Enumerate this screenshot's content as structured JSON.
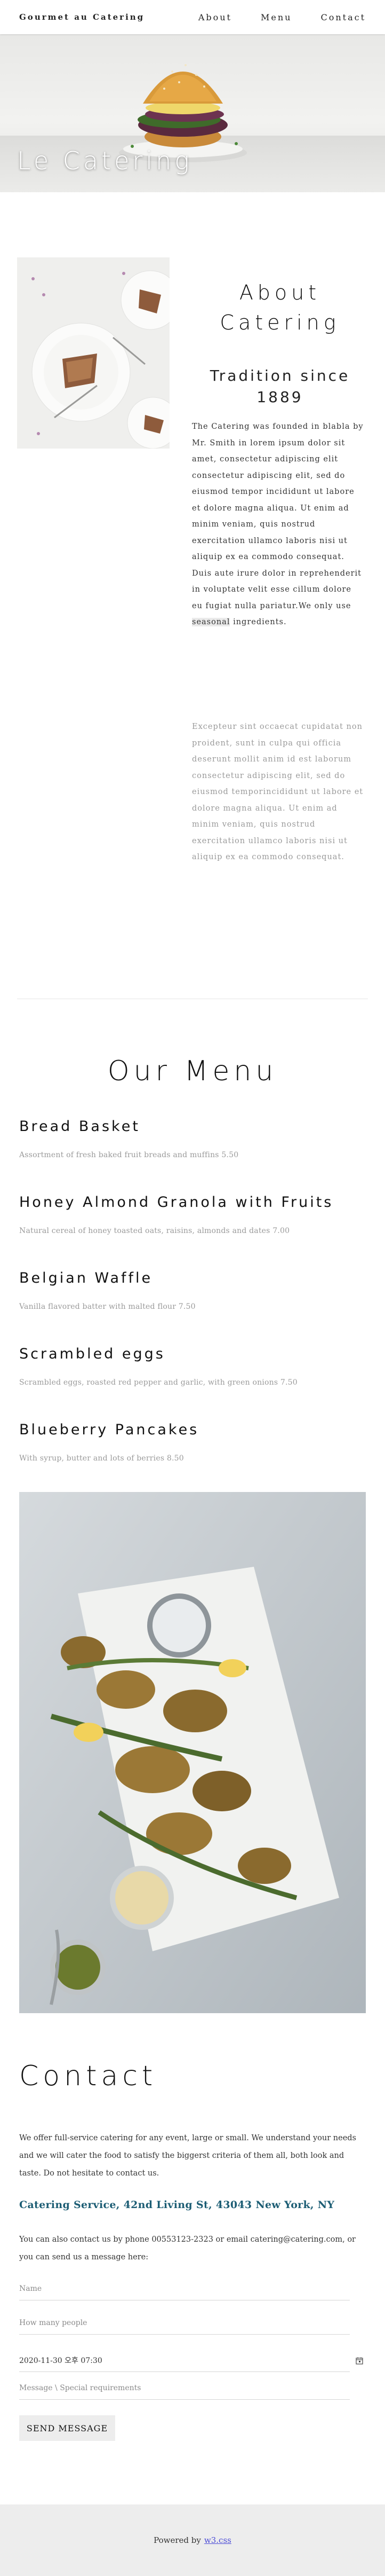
{
  "nav": {
    "brand": "Gourmet au Catering",
    "links": [
      "About",
      "Menu",
      "Contact"
    ]
  },
  "hero": {
    "title": "Le Catering"
  },
  "about": {
    "heading": "About Catering",
    "subheading": "Tradition since 1889",
    "paragraph1": "The Catering was founded in blabla by Mr. Smith in lorem ipsum dolor sit amet, consectetur adipiscing elit consectetur adipiscing elit, sed do eiusmod tempor incididunt ut labore et dolore magna aliqua. Ut enim ad minim veniam, quis nostrud exercitation ullamco laboris nisi ut aliquip ex ea commodo consequat. Duis aute irure dolor in reprehenderit in voluptate velit esse cillum dolore eu fugiat nulla pariatur.We only use ",
    "paragraph1_highlight": "seasonal",
    "paragraph1_end": " ingredients.",
    "paragraph2": "Excepteur sint occaecat cupidatat non proident, sunt in culpa qui officia deserunt mollit anim id est laborum consectetur adipiscing elit, sed do eiusmod temporincididunt ut labore et dolore magna aliqua. Ut enim ad minim veniam, quis nostrud exercitation ullamco laboris nisi ut aliquip ex ea commodo consequat."
  },
  "menu": {
    "title": "Our Menu",
    "items": [
      {
        "name": "Bread Basket",
        "desc": "Assortment of fresh baked fruit breads and muffins 5.50"
      },
      {
        "name": "Honey Almond Granola with Fruits",
        "desc": "Natural cereal of honey toasted oats, raisins, almonds and dates 7.00"
      },
      {
        "name": "Belgian Waffle",
        "desc": "Vanilla flavored batter with malted flour 7.50"
      },
      {
        "name": "Scrambled eggs",
        "desc": "Scrambled eggs, roasted red pepper and garlic, with green onions 7.50"
      },
      {
        "name": "Blueberry Pancakes",
        "desc": "With syrup, butter and lots of berries 8.50"
      }
    ]
  },
  "contact": {
    "title": "Contact",
    "paragraph": "We offer full-service catering for any event, large or small. We understand your needs and we will cater the food to satisfy the biggerst criteria of them all, both look and taste. Do not hesitate to contact us.",
    "address": "Catering Service, 42nd Living St, 43043 New York, NY",
    "paragraph2": "You can also contact us by phone 00553123-2323 or email catering@catering.com, or you can send us a message here:",
    "fields": {
      "name_placeholder": "Name",
      "people_placeholder": "How many people",
      "datetime_value": "2020-11-30 오후 07:30",
      "message_placeholder": "Message \\ Special requirements"
    },
    "send_label": "SEND MESSAGE"
  },
  "footer": {
    "powered_by": "Powered by",
    "link": "w3.css"
  },
  "colors": {
    "accent": "#1c5d74",
    "footer_bg": "#ededed",
    "link": "#4b4bd6"
  }
}
